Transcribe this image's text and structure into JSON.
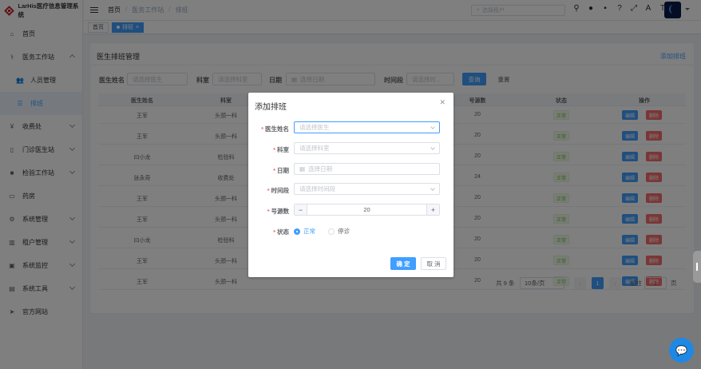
{
  "app": {
    "title": "LarHis医疗信息管理系统"
  },
  "sidebar": {
    "items": [
      {
        "label": "首页",
        "icon": "home-icon"
      },
      {
        "label": "医务工作站",
        "icon": "stethoscope-icon"
      },
      {
        "label": "人员管理",
        "icon": "user-icon"
      },
      {
        "label": "排班",
        "icon": "list-icon"
      },
      {
        "label": "收费处",
        "icon": "yen-icon"
      },
      {
        "label": "门诊医生站",
        "icon": "document-icon"
      },
      {
        "label": "检验工作站",
        "icon": "lab-icon"
      },
      {
        "label": "药房",
        "icon": "pharmacy-icon"
      },
      {
        "label": "系统管理",
        "icon": "gear-icon"
      },
      {
        "label": "租户管理",
        "icon": "chart-icon"
      },
      {
        "label": "系统监控",
        "icon": "monitor-icon"
      },
      {
        "label": "系统工具",
        "icon": "tool-icon"
      },
      {
        "label": "官方网站",
        "icon": "send-icon"
      }
    ]
  },
  "navbar": {
    "breadcrumb": [
      "首页",
      "医务工作站",
      "排班"
    ],
    "search_placeholder": "选择租户"
  },
  "tags": {
    "home": "首页",
    "active": "排班"
  },
  "card": {
    "title": "医生排班管理",
    "add_link": "添加排班"
  },
  "filter": {
    "doctor_label": "医生姓名",
    "doctor_placeholder": "请选择医生",
    "dept_label": "科室",
    "dept_placeholder": "请选择科室",
    "date_label": "日期",
    "date_placeholder": "选择日期",
    "period_label": "时间段",
    "period_placeholder": "请选择时...",
    "query": "查询",
    "reset": "重置"
  },
  "table": {
    "headers": [
      "医生姓名",
      "科室",
      "号源数",
      "状态",
      "操作"
    ],
    "rows": [
      {
        "doctor": "王军",
        "dept": "头颈一科",
        "count": "20",
        "status": "正常"
      },
      {
        "doctor": "王军",
        "dept": "头颈一科",
        "count": "20",
        "status": "正常"
      },
      {
        "doctor": "曰小龙",
        "dept": "检验科",
        "count": "20",
        "status": "正常"
      },
      {
        "doctor": "张永奇",
        "dept": "收费处",
        "count": "24",
        "status": "正常"
      },
      {
        "doctor": "王军",
        "dept": "头颈一科",
        "count": "20",
        "status": "正常"
      },
      {
        "doctor": "王军",
        "dept": "头颈一科",
        "count": "20",
        "status": "正常"
      },
      {
        "doctor": "曰小龙",
        "dept": "检验科",
        "count": "20",
        "status": "正常"
      },
      {
        "doctor": "王军",
        "dept": "头颈一科",
        "count": "20",
        "status": "正常"
      },
      {
        "doctor": "王军",
        "dept": "头颈一科",
        "count": "20",
        "status": "正常"
      }
    ],
    "edit": "编辑",
    "delete": "删除"
  },
  "pagination": {
    "total": "共 9 条",
    "page_size": "10条/页",
    "current": "1",
    "goto_label": "前往",
    "goto_value": "1",
    "page_unit": "页"
  },
  "dialog": {
    "title": "添加排班",
    "doctor_label": "医生姓名",
    "doctor_placeholder": "请选择医生",
    "dept_label": "科室",
    "dept_placeholder": "请选择科室",
    "date_label": "日期",
    "date_placeholder": "选择日期",
    "period_label": "时间段",
    "period_placeholder": "请选择时间段",
    "count_label": "号源数",
    "count_value": "20",
    "status_label": "状态",
    "status_normal": "正常",
    "status_stop": "停诊",
    "confirm": "确 定",
    "cancel": "取 消"
  },
  "colors": {
    "primary": "#409eff",
    "danger": "#f56c6c",
    "success": "#67c23a"
  }
}
